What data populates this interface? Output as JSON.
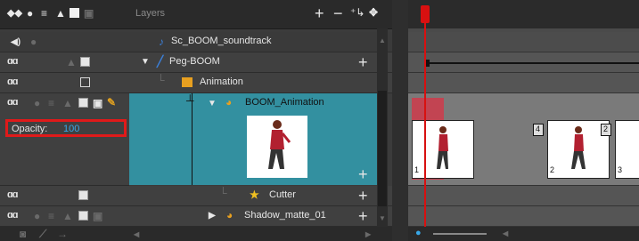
{
  "header": {
    "title": "Layers",
    "icons": [
      "animate-mode-icon",
      "onion-skin-icon",
      "database-icon",
      "color-swatch-icon",
      "collapse-icon"
    ],
    "actions": [
      "add-layer-icon",
      "delete-layer-icon",
      "add-peg-icon",
      "lock-icon"
    ]
  },
  "layers": [
    {
      "name": "Sc_BOOM_soundtrack",
      "type": "sound"
    },
    {
      "name": "Peg-BOOM",
      "type": "peg"
    },
    {
      "name": "Animation",
      "type": "group"
    },
    {
      "name": "BOOM_Animation",
      "type": "drawing",
      "selected": true
    },
    {
      "name": "Cutter",
      "type": "cutter"
    },
    {
      "name": "Shadow_matte_01",
      "type": "drawing"
    }
  ],
  "opacity": {
    "label": "Opacity:",
    "value": "100"
  },
  "timeline": {
    "frames": [
      "1",
      "2",
      "3"
    ],
    "hold_markers": [
      "4",
      "2"
    ]
  },
  "colors": {
    "selected_row": "#3390a0",
    "highlight_box": "#e01a1a",
    "playhead": "#d81010"
  }
}
